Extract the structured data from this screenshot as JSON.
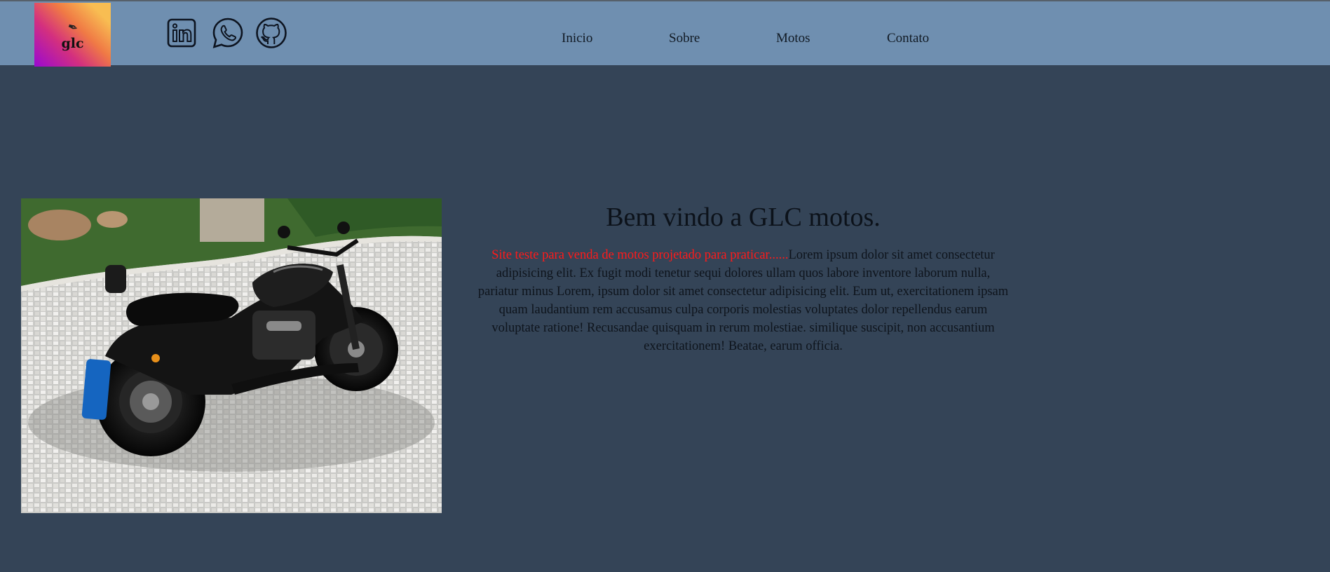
{
  "logo": {
    "text": "glc",
    "icon": "feather-icon"
  },
  "social": [
    {
      "name": "linkedin-icon"
    },
    {
      "name": "whatsapp-icon"
    },
    {
      "name": "github-icon"
    }
  ],
  "nav": {
    "items": [
      "Inicio",
      "Sobre",
      "Motos",
      "Contato"
    ]
  },
  "hero": {
    "image": "motorcycle-photo"
  },
  "main": {
    "title": "Bem vindo a GLC motos.",
    "highlight": "Site teste para venda de motos projetado para praticar......",
    "body": "Lorem ipsum dolor sit amet consectetur adipisicing elit. Ex fugit modi tenetur sequi dolores ullam quos labore inventore laborum nulla, pariatur minus Lorem, ipsum dolor sit amet consectetur adipisicing elit. Eum ut, exercitationem ipsam quam laudantium rem accusamus culpa corporis molestias voluptates dolor repellendus earum voluptate ratione! Recusandae quisquam in rerum molestiae. similique suscipit, non accusantium exercitationem! Beatae, earum officia."
  },
  "colors": {
    "header_bg": "#6f8fb0",
    "page_bg": "#344457",
    "highlight": "#ff1a1a"
  }
}
